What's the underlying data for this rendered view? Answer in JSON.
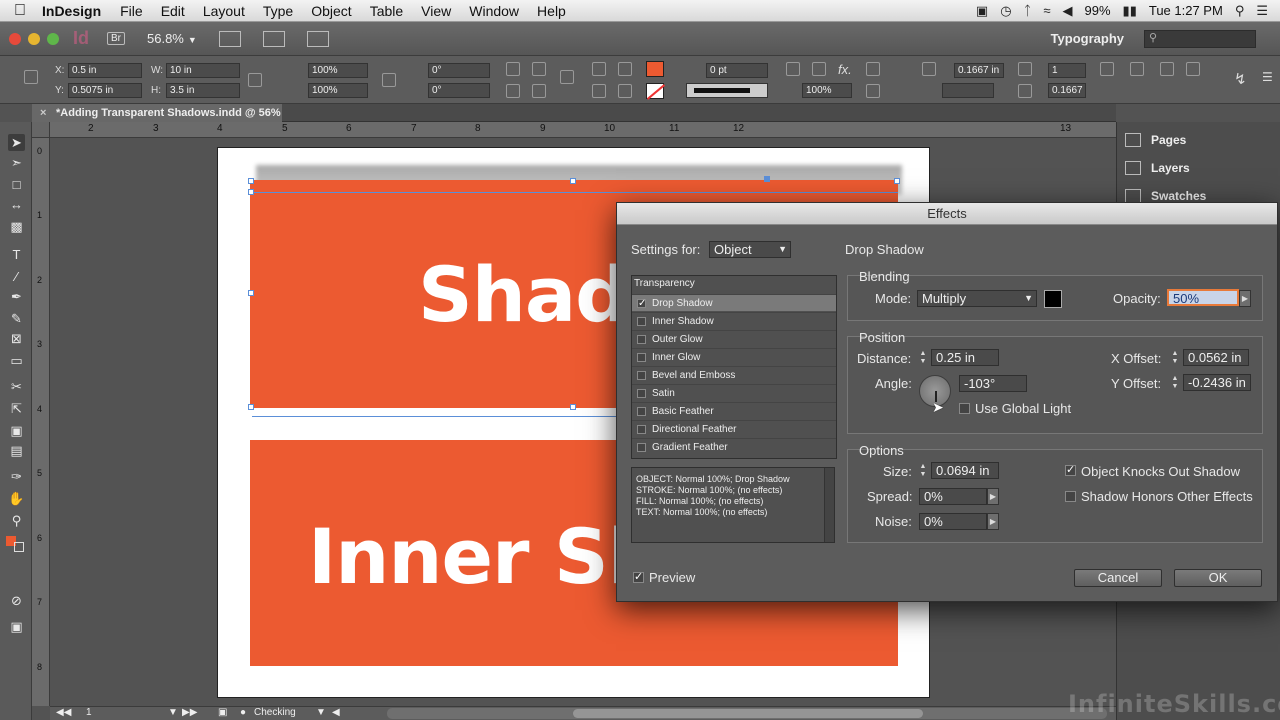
{
  "menubar": {
    "app_name": "InDesign",
    "menus": [
      "File",
      "Edit",
      "Layout",
      "Type",
      "Object",
      "Table",
      "View",
      "Window",
      "Help"
    ],
    "battery": "99%",
    "clock": "Tue 1:27 PM"
  },
  "appbar": {
    "logo": "Id",
    "bridge": "Br",
    "zoom": "56.8%",
    "workspace": "Typography"
  },
  "control_panel": {
    "x_label": "X:",
    "x_value": "0.5 in",
    "y_label": "Y:",
    "y_value": "0.5075 in",
    "w_label": "W:",
    "w_value": "10 in",
    "h_label": "H:",
    "h_value": "3.5 in",
    "scale_x": "100%",
    "scale_y": "100%",
    "rotate": "0°",
    "shear": "0°",
    "stroke_weight": "0 pt",
    "opacity": "100%",
    "offset_value": "0.1667 in",
    "columns": "1",
    "gutter": "0.1667"
  },
  "document": {
    "tab_label": "*Adding Transparent Shadows.indd @ 56%",
    "text_top": "Shado",
    "text_bottom": "Inner Sh"
  },
  "rulers": {
    "h_ticks": [
      "2",
      "3",
      "4",
      "5",
      "6",
      "7",
      "8",
      "9",
      "10",
      "11",
      "12",
      "13"
    ],
    "v_ticks": [
      "0",
      "1",
      "2",
      "3",
      "4",
      "5",
      "6",
      "7",
      "8"
    ]
  },
  "panels": {
    "items": [
      "Pages",
      "Layers",
      "Swatches"
    ]
  },
  "statusbar": {
    "page": "1",
    "preflight": "Checking"
  },
  "effects_dialog": {
    "title": "Effects",
    "settings_for_label": "Settings for:",
    "settings_for_value": "Object",
    "section_title": "Drop Shadow",
    "list_header": "Transparency",
    "effects": [
      {
        "label": "Drop Shadow",
        "checked": true,
        "selected": true
      },
      {
        "label": "Inner Shadow",
        "checked": false,
        "selected": false
      },
      {
        "label": "Outer Glow",
        "checked": false,
        "selected": false
      },
      {
        "label": "Inner Glow",
        "checked": false,
        "selected": false
      },
      {
        "label": "Bevel and Emboss",
        "checked": false,
        "selected": false
      },
      {
        "label": "Satin",
        "checked": false,
        "selected": false
      },
      {
        "label": "Basic Feather",
        "checked": false,
        "selected": false
      },
      {
        "label": "Directional Feather",
        "checked": false,
        "selected": false
      },
      {
        "label": "Gradient Feather",
        "checked": false,
        "selected": false
      }
    ],
    "summary": [
      "OBJECT: Normal 100%; Drop Shadow",
      "STROKE: Normal 100%; (no effects)",
      "FILL: Normal 100%; (no effects)",
      "TEXT: Normal 100%; (no effects)"
    ],
    "blending": {
      "title": "Blending",
      "mode_label": "Mode:",
      "mode_value": "Multiply",
      "opacity_label": "Opacity:",
      "opacity_value": "50%",
      "shadow_color": "#000000"
    },
    "position": {
      "title": "Position",
      "distance_label": "Distance:",
      "distance_value": "0.25 in",
      "angle_label": "Angle:",
      "angle_value": "-103°",
      "global_light_label": "Use Global Light",
      "global_light_checked": false,
      "x_offset_label": "X Offset:",
      "x_offset_value": "0.0562 in",
      "y_offset_label": "Y Offset:",
      "y_offset_value": "-0.2436 in"
    },
    "options": {
      "title": "Options",
      "size_label": "Size:",
      "size_value": "0.0694 in",
      "spread_label": "Spread:",
      "spread_value": "0%",
      "noise_label": "Noise:",
      "noise_value": "0%",
      "knocks_out_label": "Object Knocks Out Shadow",
      "knocks_out_checked": true,
      "honors_label": "Shadow Honors Other Effects",
      "honors_checked": false
    },
    "preview_label": "Preview",
    "preview_checked": true,
    "cancel_label": "Cancel",
    "ok_label": "OK"
  },
  "watermark": "InfiniteSkills.com",
  "colors": {
    "banner": "#ec5a31",
    "selection": "#5b8fd8"
  }
}
